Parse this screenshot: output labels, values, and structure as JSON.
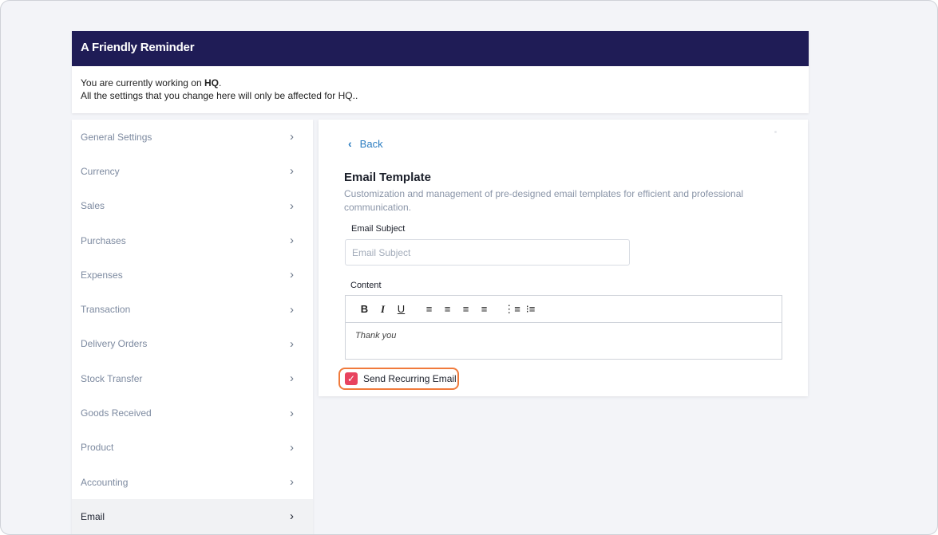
{
  "reminder": {
    "title": "A Friendly Reminder",
    "line1_prefix": "You are currently working on ",
    "line1_bold": "HQ",
    "line1_suffix": ".",
    "line2": "All the settings that you change here will only be affected for HQ.."
  },
  "sidebar": {
    "items": [
      {
        "label": "General Settings"
      },
      {
        "label": "Currency"
      },
      {
        "label": "Sales"
      },
      {
        "label": "Purchases"
      },
      {
        "label": "Expenses"
      },
      {
        "label": "Transaction"
      },
      {
        "label": "Delivery Orders"
      },
      {
        "label": "Stock Transfer"
      },
      {
        "label": "Goods Received"
      },
      {
        "label": "Product"
      },
      {
        "label": "Accounting"
      },
      {
        "label": "Email",
        "active": true
      }
    ],
    "chevron": "›"
  },
  "panel": {
    "back_label": "Back",
    "back_icon": "‹",
    "title": "Email Template",
    "description": "Customization and management of pre-designed email templates for efficient and professional communication.",
    "subject_label": "Email Subject",
    "subject_placeholder": "Email Subject",
    "subject_value": "",
    "content_label": "Content",
    "toolbar": {
      "bold": "B",
      "italic": "I",
      "underline": "U",
      "align_left": "≡",
      "align_center": "≡",
      "align_right": "≡",
      "justify": "≡",
      "ordered_list": "⋮≡",
      "bullet_list": "⁝≡"
    },
    "content_text": "Thank you",
    "recurring_label": "Send Recurring Email",
    "recurring_checked": true,
    "checkmark": "✓"
  },
  "colors": {
    "header_bg": "#1f1c56",
    "link": "#2a7cc0",
    "checkbox": "#e8435f",
    "highlight": "#f07a3b"
  }
}
